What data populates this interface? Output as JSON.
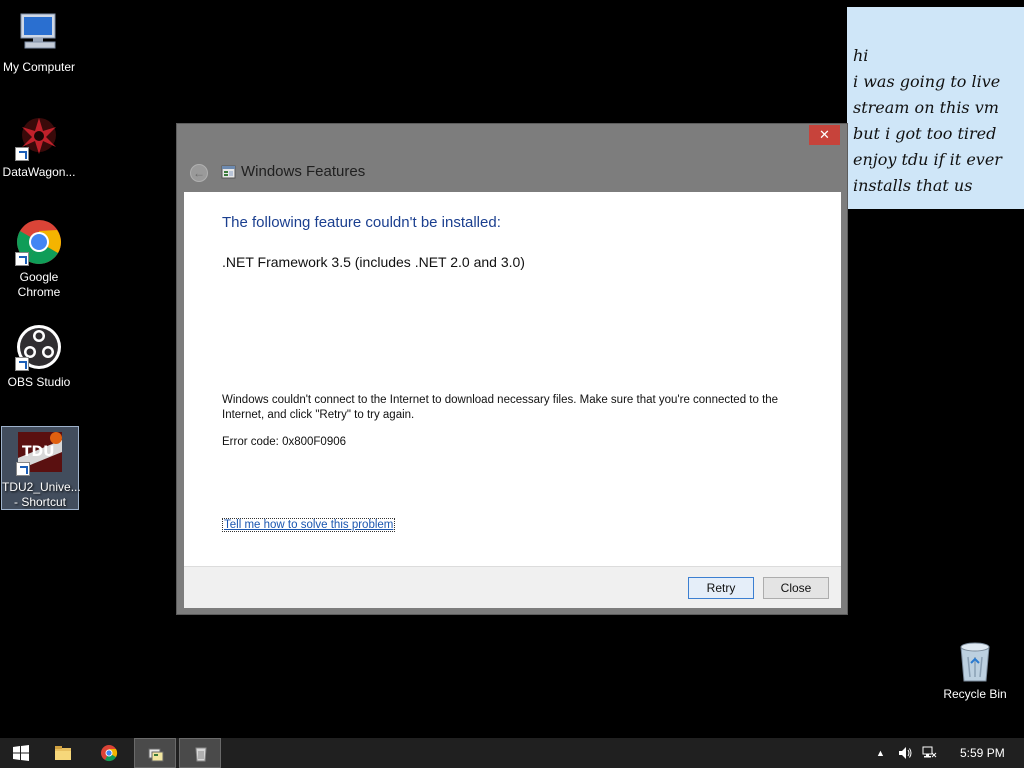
{
  "desktop": {
    "icons": [
      {
        "label": "My Computer",
        "icon": "computer-icon"
      },
      {
        "label": "DataWagon...",
        "icon": "datawagon-icon"
      },
      {
        "label": "Google\nChrome",
        "icon": "chrome-icon"
      },
      {
        "label": "OBS Studio",
        "icon": "obs-icon"
      },
      {
        "label": "TDU2_Unive...\n- Shortcut",
        "icon": "tdu2-icon"
      }
    ],
    "recycle_bin": {
      "label": "Recycle Bin",
      "icon": "recycle-bin-icon"
    }
  },
  "sticky_note": {
    "lines": [
      "hi",
      "i was going to live",
      "stream on this vm",
      "but i got too tired",
      "enjoy tdu if it ever",
      "installs that us"
    ],
    "color": "#cfe6f8"
  },
  "dialog": {
    "title": "Windows Features",
    "heading": "The following feature couldn't be installed:",
    "feature": ".NET Framework 3.5 (includes .NET 2.0 and 3.0)",
    "message": "Windows couldn't connect to the Internet to download necessary files. Make sure that you're connected to the Internet, and click \"Retry\" to try again.",
    "error_code": "Error code: 0x800F0906",
    "help_link": "Tell me how to solve this problem",
    "retry_label": "Retry",
    "close_label": "Close",
    "close_glyph": "✕",
    "back_glyph": "←"
  },
  "taskbar": {
    "items": [
      "start-icon",
      "file-explorer-icon",
      "chrome-icon",
      "windows-features-icon",
      "recycle-app-icon"
    ],
    "clock": "5:59 PM",
    "tray": {
      "chevron": "▲"
    }
  },
  "colors": {
    "accent": "#1b3f8f",
    "close_red": "#c7433b",
    "link": "#1a56b0"
  }
}
